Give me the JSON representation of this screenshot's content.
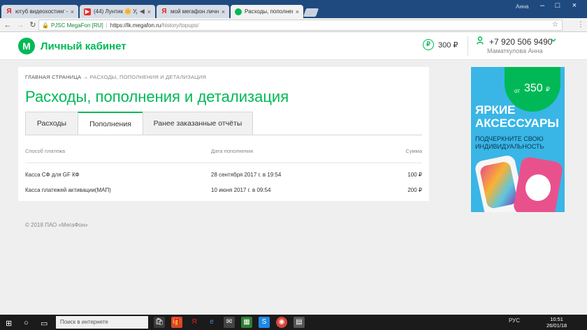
{
  "browser": {
    "tabs": [
      {
        "title": "ютуб видеохостинг — Я",
        "favicon": "yandex-icon",
        "active": false
      },
      {
        "title": "(44) Лунтик 🌼 Удив",
        "favicon": "youtube-icon",
        "active": false
      },
      {
        "title": "мой мегафон личный к",
        "favicon": "yandex-icon",
        "active": false
      },
      {
        "title": "Расходы, пополнения и",
        "favicon": "megafon-icon",
        "active": true
      }
    ],
    "window_user": "Анна",
    "security_label": "PJSC MegaFon [RU]",
    "url_host": "https://lk.megafon.ru",
    "url_path": "/history/topups/"
  },
  "header": {
    "logo_glyph": "М",
    "cabinet_title": "Личный кабинет",
    "balance": "300 ₽",
    "ruble_glyph": "₽",
    "phone": "+7 920 506 9490",
    "user_name": "Маматкулова Анна"
  },
  "breadcrumb": {
    "home": "ГЛАВНАЯ СТРАНИЦА",
    "arrow": "→",
    "current": "РАСХОДЫ, ПОПОЛНЕНИЯ И ДЕТАЛИЗАЦИЯ"
  },
  "page_title": "Расходы, пополнения и детализация",
  "tabs": [
    {
      "label": "Расходы",
      "active": false
    },
    {
      "label": "Пополнения",
      "active": true
    },
    {
      "label": "Ранее заказанные отчёты",
      "active": false
    }
  ],
  "table": {
    "columns": [
      "Способ платежа",
      "Дата пополнения",
      "Сумма"
    ],
    "rows": [
      {
        "method": "Касса СФ для GF КФ",
        "date": "28 сентября 2017 г. в 19:54",
        "amount": "100 ₽"
      },
      {
        "method": "Касса платежей активации(МАП)",
        "date": "10 июня 2017 г. в 09:54",
        "amount": "200 ₽"
      }
    ]
  },
  "footer": "© 2018 ПАО «МегаФон»",
  "ad": {
    "price_prefix": "от",
    "price": "350",
    "currency": "₽",
    "headline_1": "ЯРКИЕ",
    "headline_2": "АКСЕССУАРЫ",
    "subline": "ПОДЧЕРКНИТЕ СВОЮ ИНДИВИДУАЛЬНОСТЬ"
  },
  "taskbar": {
    "search_placeholder": "Поиск в интернете",
    "language": "РУС",
    "time": "10:51",
    "date": "26/01/18"
  },
  "colors": {
    "brand_green": "#00b956",
    "ad_blue": "#39b6e6"
  }
}
